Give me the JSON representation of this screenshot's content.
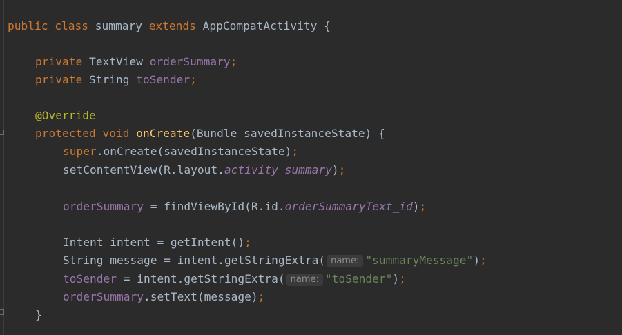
{
  "editor": {
    "code": {
      "l1": {
        "kw_public": "public",
        "kw_class": "class",
        "class_name": " summary ",
        "kw_extends": "extends",
        "super_name": " AppCompatActivity {"
      },
      "l3": {
        "kw_private": "private",
        "type": " TextView ",
        "field": "orderSummary",
        "semi": ";"
      },
      "l4": {
        "kw_private": "private",
        "type": " String ",
        "field": "toSender",
        "semi": ";"
      },
      "l6": {
        "annotation": "@Override"
      },
      "l7": {
        "kw_protected": "protected",
        "kw_void": "void",
        "method": "onCreate",
        "params": "(Bundle savedInstanceState) {"
      },
      "l8": {
        "kw_super": "super",
        "call": ".onCreate(savedInstanceState)",
        "semi": ";"
      },
      "l9": {
        "call": "setContentView(R.layout.",
        "const": "activity_summary",
        "close": ")",
        "semi": ";"
      },
      "l11": {
        "field": "orderSummary",
        "eq": " = findViewById(R.id.",
        "const": "orderSummaryText_id",
        "close": ")",
        "semi": ";"
      },
      "l13": {
        "text": "Intent intent = getIntent()",
        "semi": ";"
      },
      "l14": {
        "text": "String message = intent.getStringExtra(",
        "hint": "name:",
        "str": "\"summaryMessage\"",
        "close": ")",
        "semi": ";"
      },
      "l15": {
        "field": "toSender",
        "text": " = intent.getStringExtra(",
        "hint": "name:",
        "str": "\"toSender\"",
        "close": ")",
        "semi": ";"
      },
      "l16": {
        "field": "orderSummary",
        "text": ".setText(message)",
        "semi": ";"
      },
      "l17": {
        "brace": "}"
      }
    }
  },
  "colors": {
    "background": "#2b2b2b",
    "default_text": "#a9b7c6",
    "keyword": "#cc7832",
    "field": "#9876aa",
    "annotation": "#bbb529",
    "method_decl": "#ffc66d",
    "string": "#6a8759",
    "hint_bg": "#3b3b3b",
    "hint_text": "#8c8c8c"
  },
  "icons": [
    "fold-marker-icon"
  ]
}
